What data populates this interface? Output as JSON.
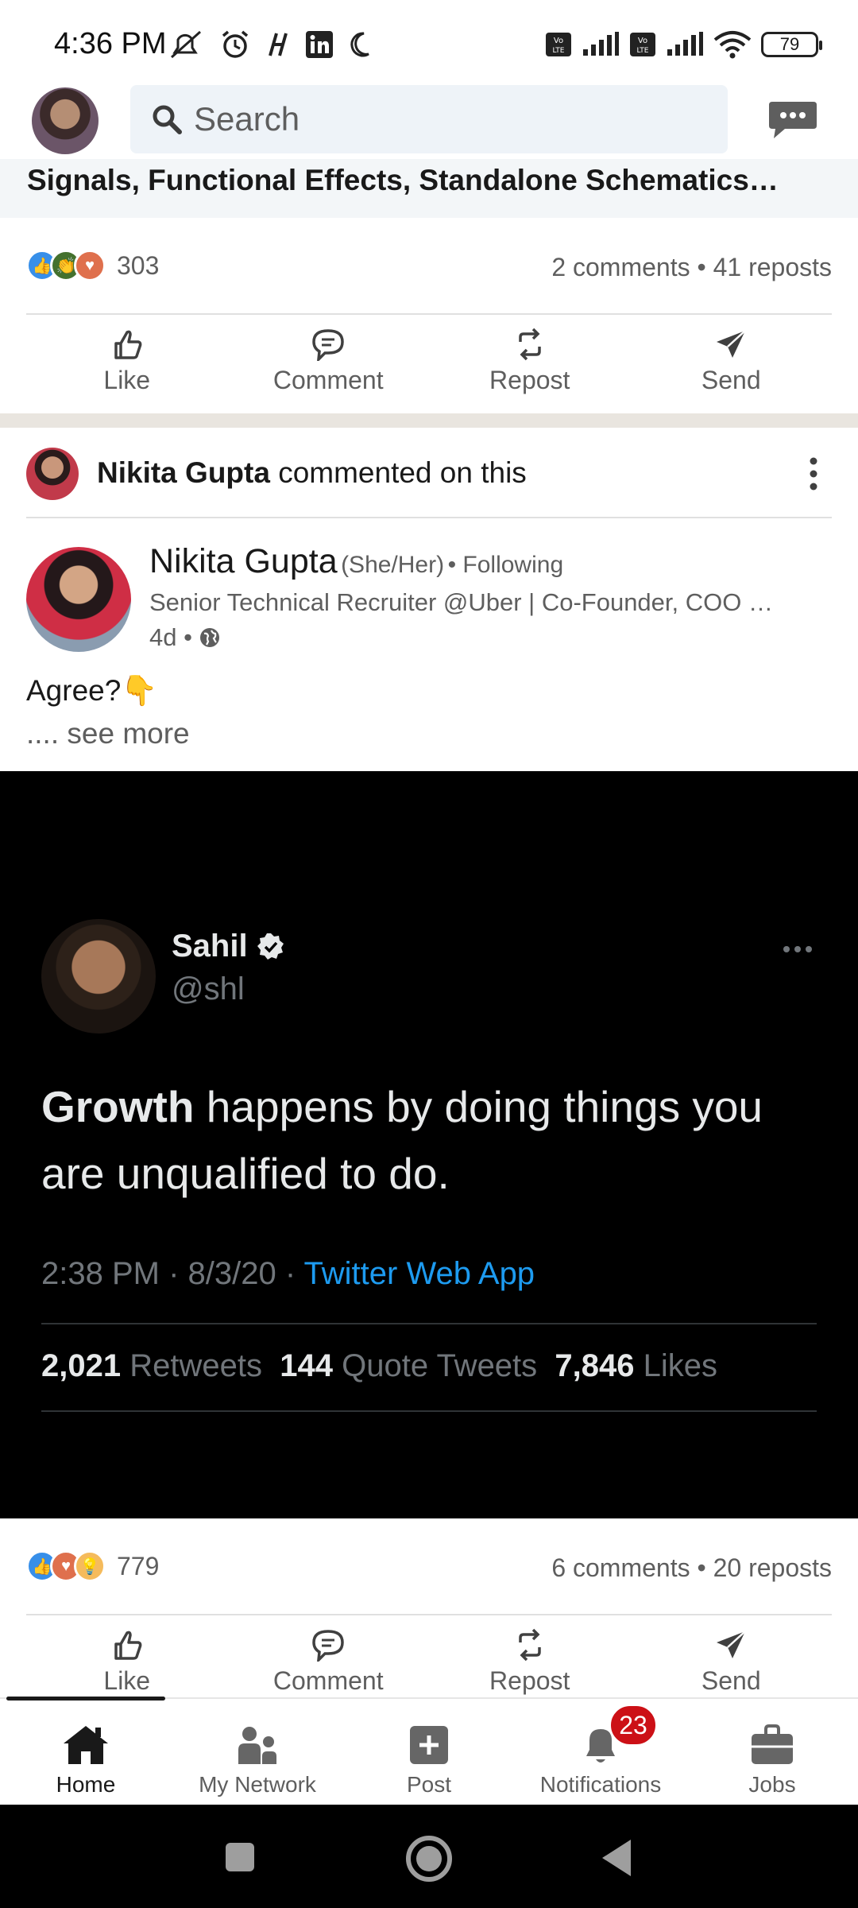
{
  "status_bar": {
    "time": "4:36 PM",
    "battery": "79",
    "icons": [
      "mute-icon",
      "alarm-icon",
      "nfc-icon",
      "linkedin-icon",
      "moon-icon",
      "volte-icon",
      "signal-icon",
      "volte-icon",
      "signal-icon",
      "wifi-icon",
      "battery-icon"
    ]
  },
  "header": {
    "search_placeholder": "Search",
    "messaging_icon": "chat-bubble-icon"
  },
  "post_tail": {
    "text": "Signals, Functional Effects, Standalone Schematics…",
    "reaction_count": "303",
    "meta": "2 comments • 41 reposts"
  },
  "actions": {
    "like": "Like",
    "comment": "Comment",
    "repost": "Repost",
    "send": "Send"
  },
  "activity": {
    "name": "Nikita Gupta",
    "action_text": "commented on this"
  },
  "post": {
    "author_name": "Nikita Gupta",
    "pronouns": "(She/Her)",
    "connection": "• Following",
    "headline": "Senior Technical Recruiter @Uber | Co-Founder, COO …",
    "time": "4d •",
    "body": "Agree?👇",
    "see_more": ".... see more",
    "reaction_count": "779",
    "meta": "6 comments • 20 reposts"
  },
  "tweet": {
    "name": "Sahil",
    "handle": "@shl",
    "text_bold": "Growth",
    "text_rest": " happens by doing things you are unqualified to do.",
    "time": "2:38 PM · 8/3/20 · ",
    "app": "Twitter Web App",
    "retweets": "2,021",
    "retweets_label": "Retweets",
    "quotes": "144",
    "quotes_label": "Quote Tweets",
    "likes": "7,846",
    "likes_label": "Likes"
  },
  "bottom_nav": {
    "items": [
      {
        "label": "Home",
        "icon": "home-icon"
      },
      {
        "label": "My Network",
        "icon": "people-icon"
      },
      {
        "label": "Post",
        "icon": "plus-square-icon"
      },
      {
        "label": "Notifications",
        "icon": "bell-icon",
        "badge": "23"
      },
      {
        "label": "Jobs",
        "icon": "briefcase-icon"
      }
    ]
  },
  "colors": {
    "accent": "#0a66c2",
    "badge": "#cc1016",
    "twitter_blue": "#1d9bf0"
  }
}
